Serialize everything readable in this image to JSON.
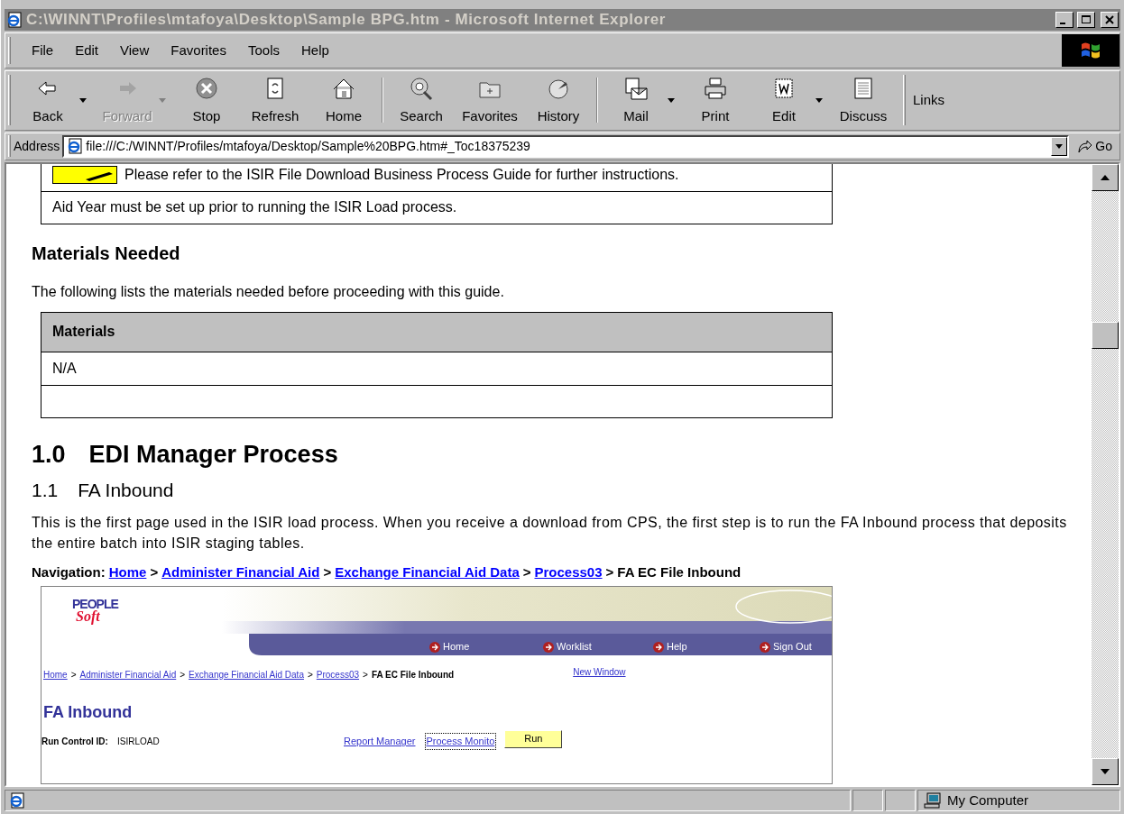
{
  "window": {
    "title": "C:\\WINNT\\Profiles\\mtafoya\\Desktop\\Sample BPG.htm - Microsoft Internet Explorer",
    "active": false
  },
  "menu": [
    "File",
    "Edit",
    "View",
    "Favorites",
    "Tools",
    "Help"
  ],
  "toolbar": [
    {
      "kind": "button",
      "label": "Back",
      "disabled": false,
      "dropdown": true
    },
    {
      "kind": "button",
      "label": "Forward",
      "disabled": true,
      "dropdown": true
    },
    {
      "kind": "button",
      "label": "Stop",
      "disabled": false,
      "dropdown": false
    },
    {
      "kind": "button",
      "label": "Refresh",
      "disabled": false,
      "dropdown": false
    },
    {
      "kind": "button",
      "label": "Home",
      "disabled": false,
      "dropdown": false
    },
    {
      "kind": "separator"
    },
    {
      "kind": "button",
      "label": "Search",
      "disabled": false,
      "dropdown": false
    },
    {
      "kind": "button",
      "label": "Favorites",
      "disabled": false,
      "dropdown": false
    },
    {
      "kind": "button",
      "label": "History",
      "disabled": false,
      "dropdown": false
    },
    {
      "kind": "separator"
    },
    {
      "kind": "button",
      "label": "Mail",
      "disabled": false,
      "dropdown": true
    },
    {
      "kind": "button",
      "label": "Print",
      "disabled": false,
      "dropdown": false
    },
    {
      "kind": "button",
      "label": "Edit",
      "disabled": false,
      "dropdown": true
    },
    {
      "kind": "button",
      "label": "Discuss",
      "disabled": false,
      "dropdown": false
    }
  ],
  "links": "Links",
  "address": {
    "label": "Address",
    "value": "file:///C:/WINNT/Profiles/mtafoya/Desktop/Sample%20BPG.htm#_Toc18375239",
    "go": "Go"
  },
  "content": {
    "note_table": [
      {
        "kind": "note",
        "text": "Please refer to the ISIR File Download Business Process Guide for further instructions."
      },
      {
        "kind": "text",
        "text": "Aid Year must be set up prior to running the ISIR Load process."
      }
    ],
    "materials_heading": "Materials Needed",
    "materials_intro": "The following lists the materials needed before proceeding with this guide.",
    "materials_table": {
      "header": "Materials",
      "rows": [
        {
          "blank": false,
          "text": "N/A"
        },
        {
          "blank": true
        }
      ]
    },
    "section": {
      "number": "1.0",
      "title": "EDI Manager Process"
    },
    "subsection": {
      "number": "1.1",
      "title": "FA Inbound"
    },
    "paragraph": "This is the first page used in the ISIR load process. When you receive a download from CPS, the first step is to run the FA Inbound process that deposits the entire batch into ISIR staging tables.",
    "navigation": {
      "label": "Navigation:",
      "items": [
        {
          "kind": "link",
          "text": "Home"
        },
        {
          "kind": "sep",
          "text": ">"
        },
        {
          "kind": "link",
          "text": "Administer Financial Aid"
        },
        {
          "kind": "sep",
          "text": ">"
        },
        {
          "kind": "link",
          "text": "Exchange Financial Aid Data"
        },
        {
          "kind": "sep",
          "text": ">"
        },
        {
          "kind": "link",
          "text": "Process03"
        },
        {
          "kind": "sep",
          "text": ">"
        },
        {
          "kind": "current",
          "text": "FA EC File Inbound"
        }
      ]
    },
    "screenshot": {
      "logo": {
        "top": "PEOPLE",
        "bottom": "Soft"
      },
      "nav_links": [
        "Home",
        "Worklist",
        "Help",
        "Sign Out"
      ],
      "breadcrumb": [
        {
          "kind": "link",
          "text": "Home"
        },
        {
          "kind": "sep",
          "text": ">"
        },
        {
          "kind": "link",
          "text": "Administer Financial Aid"
        },
        {
          "kind": "sep",
          "text": ">"
        },
        {
          "kind": "link",
          "text": "Exchange Financial Aid Data"
        },
        {
          "kind": "sep",
          "text": ">"
        },
        {
          "kind": "link",
          "text": "Process03"
        },
        {
          "kind": "sep",
          "text": ">"
        },
        {
          "kind": "current",
          "text": "FA EC File Inbound"
        }
      ],
      "new_window": "New Window",
      "page_title": "FA Inbound",
      "run_control": {
        "label": "Run Control ID:",
        "value": "ISIRLOAD"
      },
      "links": [
        {
          "text": "Report Manager",
          "focused": false
        },
        {
          "text": "Process Monito",
          "focused": true
        }
      ],
      "run_button": "Run"
    }
  },
  "status_bar": {
    "zone": "My Computer"
  }
}
